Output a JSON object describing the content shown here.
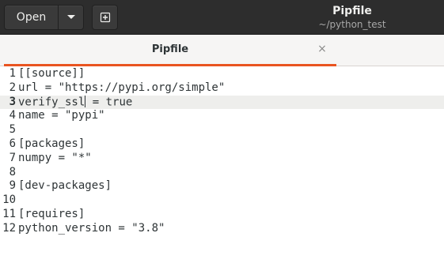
{
  "header": {
    "open_label": "Open",
    "open_arrow_icon": "chevron-down-icon",
    "new_tab_icon": "new-document-icon",
    "title": "Pipfile",
    "subtitle": "~/python_test"
  },
  "tab": {
    "label": "Pipfile",
    "close_icon": "close-icon",
    "close_glyph": "×",
    "accent_color": "#e95420"
  },
  "editor": {
    "current_line": 3,
    "lines": [
      {
        "num": "1",
        "text": "[[source]]"
      },
      {
        "num": "2",
        "text": "url = \"https://pypi.org/simple\""
      },
      {
        "num": "3",
        "text_before": "verify_ssl",
        "text_after": " = true"
      },
      {
        "num": "4",
        "text": "name = \"pypi\""
      },
      {
        "num": "5",
        "text": ""
      },
      {
        "num": "6",
        "text": "[packages]"
      },
      {
        "num": "7",
        "text": "numpy = \"*\""
      },
      {
        "num": "8",
        "text": ""
      },
      {
        "num": "9",
        "text": "[dev-packages]"
      },
      {
        "num": "10",
        "text": ""
      },
      {
        "num": "11",
        "text": "[requires]"
      },
      {
        "num": "12",
        "text": "python_version = \"3.8\""
      }
    ]
  }
}
